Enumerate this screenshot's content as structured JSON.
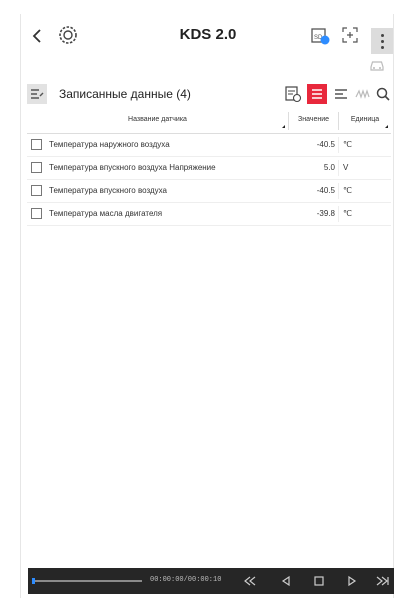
{
  "header": {
    "title": "KDS 2.0",
    "back_icon": "chevron-left-icon",
    "logo_icon": "gear-logo-icon",
    "sd_icon": "sd-card-icon",
    "sd_label": "SD",
    "fullscreen_icon": "expand-icon",
    "menu_icon": "more-vertical-icon",
    "car_icon": "car-icon"
  },
  "section": {
    "title": "Записанные данные (4)",
    "icon": "recorded-data-icon",
    "tools": [
      "report-icon",
      "list-view-icon",
      "align-icon",
      "graph-icon",
      "search-icon"
    ],
    "active_tool": "list-view-icon"
  },
  "table": {
    "columns": [
      "Название датчика",
      "Значение",
      "Единица"
    ],
    "rows": [
      {
        "name": "Температура наружного воздуха",
        "value": "-40.5",
        "unit": "℃"
      },
      {
        "name": "Температура впускного воздуха Напряжение",
        "value": "5.0",
        "unit": "V"
      },
      {
        "name": "Температура впускного воздуха",
        "value": "-40.5",
        "unit": "℃"
      },
      {
        "name": "Температура масла двигателя",
        "value": "-39.8",
        "unit": "℃"
      }
    ]
  },
  "player": {
    "time": "00:00:00/00:00:10",
    "progress": 0.0,
    "buttons": [
      "rewind-icon",
      "step-back-icon",
      "stop-icon",
      "play-icon",
      "fast-forward-icon"
    ]
  },
  "colors": {
    "accent": "#e8283c",
    "player_bg": "#262626",
    "progress": "#2d8cff"
  }
}
